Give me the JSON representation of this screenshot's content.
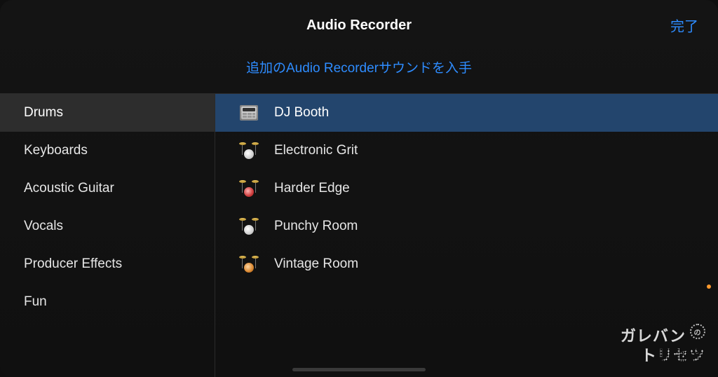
{
  "header": {
    "title": "Audio Recorder",
    "done_label": "完了"
  },
  "subheader": {
    "link_label": "追加のAudio Recorderサウンドを入手"
  },
  "sidebar": {
    "categories": [
      {
        "label": "Drums",
        "selected": true
      },
      {
        "label": "Keyboards",
        "selected": false
      },
      {
        "label": "Acoustic Guitar",
        "selected": false
      },
      {
        "label": "Vocals",
        "selected": false
      },
      {
        "label": "Producer Effects",
        "selected": false
      },
      {
        "label": "Fun",
        "selected": false
      }
    ]
  },
  "content": {
    "presets": [
      {
        "label": "DJ Booth",
        "icon": "drum-machine-icon",
        "selected": true,
        "variant": "machine"
      },
      {
        "label": "Electronic Grit",
        "icon": "drum-kit-icon",
        "selected": false,
        "variant": "white"
      },
      {
        "label": "Harder Edge",
        "icon": "drum-kit-icon",
        "selected": false,
        "variant": "red"
      },
      {
        "label": "Punchy Room",
        "icon": "drum-kit-icon",
        "selected": false,
        "variant": "white"
      },
      {
        "label": "Vintage Room",
        "icon": "drum-kit-icon",
        "selected": false,
        "variant": "orange"
      }
    ]
  },
  "watermark": {
    "line1": "ガレバン",
    "bubble": "の",
    "line2_prefix": "ト",
    "line2_dotted": "リセツ"
  }
}
